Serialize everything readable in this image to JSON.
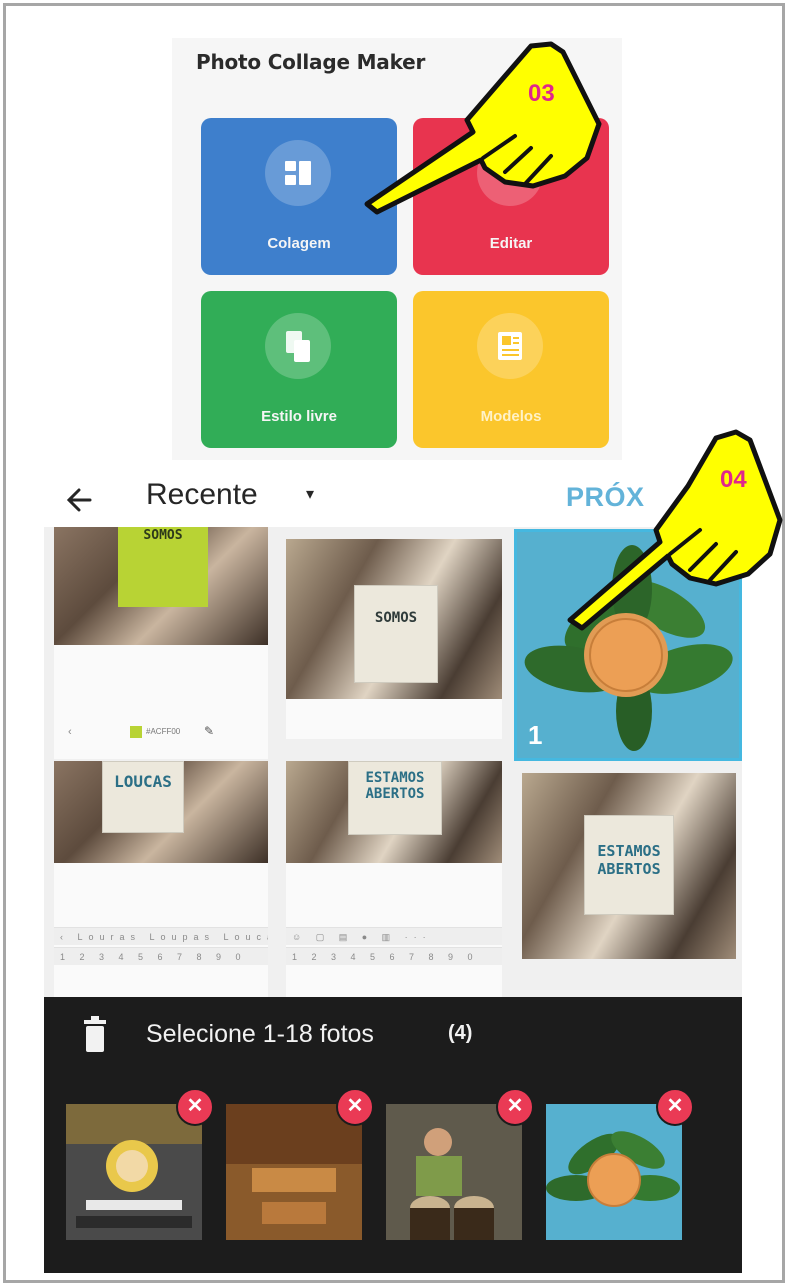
{
  "app": {
    "title": "Photo Collage Maker"
  },
  "tiles": [
    {
      "label": "Colagem",
      "icon": "collage-grid-icon",
      "color": "#3e7fcc"
    },
    {
      "label": "Editar",
      "icon": "edit-icon",
      "color": "#e8344f"
    },
    {
      "label": "Estilo livre",
      "icon": "freestyle-icon",
      "color": "#31ad57"
    },
    {
      "label": "Modelos",
      "icon": "template-icon",
      "color": "#fbc62c"
    }
  ],
  "picker": {
    "album": "Recente",
    "caret": "▾",
    "next_label": "PRÓX"
  },
  "grid": {
    "selected_index": "1",
    "cards": {
      "somos_a": "SOMOS",
      "somos_b": "SOMOS",
      "loucas": "LOUCAS",
      "estamos_a": "ESTAMOS",
      "abertos_a": "ABERTOS",
      "estamos_b": "ESTAMOS",
      "abertos_b": "ABERTOS"
    },
    "color_chip": "#ACFF00",
    "kbd_top_left": "‹  Louras  Loupas  Louca  ···",
    "kbd_num": "1 2 3 4 5 6 7 8 9 0"
  },
  "tray": {
    "label": "Selecione 1-18 fotos",
    "count": "(4)",
    "remove_symbol": "✕"
  },
  "pointers": [
    {
      "label": "03",
      "icon": "pointing-hand-icon"
    },
    {
      "label": "04",
      "icon": "pointing-hand-icon"
    }
  ],
  "colors": {
    "accent": "#63b3d9",
    "selection": "#45b8e0",
    "remove": "#ea3a55",
    "pointer_fill": "#ffff00",
    "step_label": "#e0268c"
  }
}
